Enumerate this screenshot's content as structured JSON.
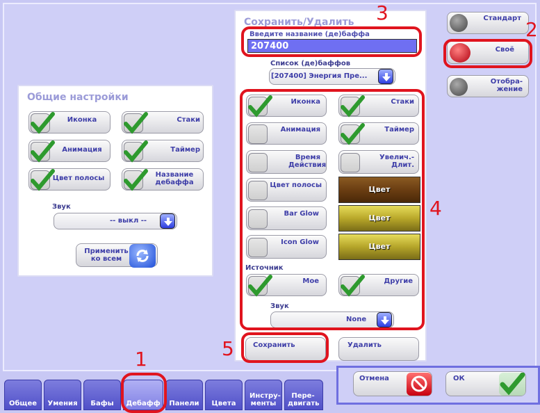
{
  "general": {
    "title": "Общие настройки",
    "items": [
      {
        "label": "Иконка",
        "checked": true
      },
      {
        "label": "Стаки",
        "checked": true
      },
      {
        "label": "Анимация",
        "checked": true
      },
      {
        "label": "Таймер",
        "checked": true
      },
      {
        "label": "Цвет полосы",
        "checked": true
      },
      {
        "label": "Название дебаффа",
        "checked": true
      }
    ],
    "sound_label": "Звук",
    "sound_value": "-- выкл --",
    "apply_label": "Применить ко всем"
  },
  "save_delete": {
    "title": "Сохранить/Удалить",
    "name_label": "Введите название (де)баффа",
    "name_value": "207400",
    "list_label": "Список (де)баффов",
    "list_value": "[207400] Энергия Пре..."
  },
  "options": {
    "items": [
      {
        "label": "Иконка",
        "checked": true
      },
      {
        "label": "Стаки",
        "checked": true
      },
      {
        "label": "Анимация",
        "checked": false
      },
      {
        "label": "Таймер",
        "checked": true
      },
      {
        "label": "Время Действия",
        "checked": false
      },
      {
        "label": "Увелич.- Длит.",
        "checked": false
      },
      {
        "label": "Цвет полосы",
        "checked": false
      },
      {
        "label": "Bar Glow",
        "checked": false
      },
      {
        "label": "Icon Glow",
        "checked": false
      }
    ],
    "color_label": "Цвет",
    "colors": [
      "#6b3e12",
      "#b9a82a",
      "#b5a52a"
    ],
    "source_label": "Источник",
    "source_items": [
      {
        "label": "Мое",
        "checked": true
      },
      {
        "label": "Другие",
        "checked": true
      }
    ],
    "sound_label": "Звук",
    "sound_value": "None"
  },
  "buttons": {
    "save": "Сохранить",
    "delete": "Удалить",
    "cancel": "Отмена",
    "ok": "ОК"
  },
  "profiles": [
    {
      "label": "Стандарт",
      "state": "off"
    },
    {
      "label": "Своё",
      "state": "on"
    },
    {
      "label": "Отобра- жение",
      "state": "off"
    }
  ],
  "tabs": [
    {
      "label": "Общее"
    },
    {
      "label": "Умения"
    },
    {
      "label": "Бафы"
    },
    {
      "label": "Дебафф"
    },
    {
      "label": "Панели"
    },
    {
      "label": "Цвета"
    },
    {
      "label": "Инстру- менты"
    },
    {
      "label": "Пере- двигать"
    }
  ],
  "annotations": [
    "1",
    "2",
    "3",
    "4",
    "5"
  ],
  "colors": {
    "accent": "#3e3ea8",
    "annotation": "#e0141e",
    "input_bg": "#6f6ff2"
  }
}
